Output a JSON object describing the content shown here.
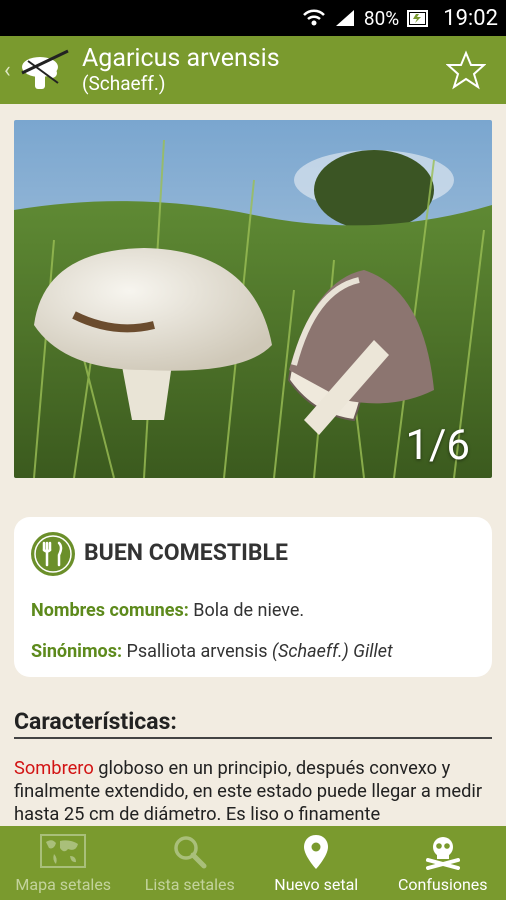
{
  "status": {
    "battery": "80%",
    "time": "19:02"
  },
  "header": {
    "title": "Agaricus arvensis",
    "subtitle": "(Schaeff.)",
    "back": "‹"
  },
  "gallery": {
    "counter": "1/6"
  },
  "card": {
    "edibility": "BUEN COMESTIBLE",
    "common_label": "Nombres comunes:",
    "common_value": " Bola de nieve.",
    "syn_label": "Sinónimos:",
    "syn_value_a": " Psalliota arvensis ",
    "syn_value_b": "(Schaeff.)",
    "syn_value_c": " Gillet"
  },
  "section": {
    "title": "Características:",
    "highlight": "Sombrero",
    "text": " globoso en un principio, después convexo y finalmente extendido, en este estado puede llegar a medir hasta 25 cm de diámetro. Es liso o finamente"
  },
  "nav": [
    {
      "label": "Mapa setales",
      "icon": "map-icon"
    },
    {
      "label": "Lista setales",
      "icon": "search-icon"
    },
    {
      "label": "Nuevo setal",
      "icon": "location-pin-icon"
    },
    {
      "label": "Confusiones",
      "icon": "skull-icon"
    }
  ],
  "colors": {
    "brand_green": "#7a9a2e",
    "accent_green": "#5d8a1c",
    "highlight_red": "#d21414"
  }
}
